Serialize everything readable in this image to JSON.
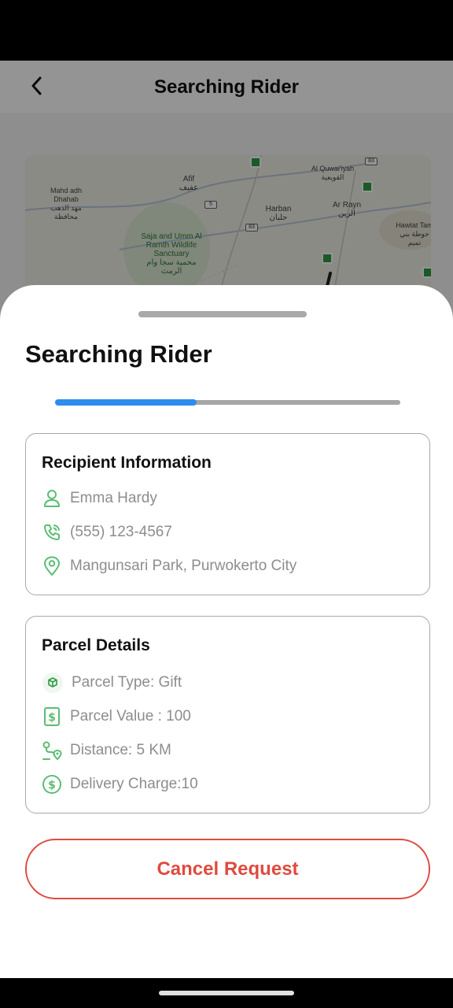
{
  "header": {
    "title": "Searching Rider"
  },
  "map": {
    "labels": [
      {
        "text": "Mahd adh Dhahab\nمهد الذهب محافظة",
        "cls": ""
      },
      {
        "text": "Afif\nعفيف",
        "cls": ""
      },
      {
        "text": "Al Quwai'iyah\nالقويعية",
        "cls": ""
      },
      {
        "text": "Harban\nحلبان",
        "cls": ""
      },
      {
        "text": "Ar Rayn\nالرين",
        "cls": ""
      },
      {
        "text": "Hawtat Tam\nحوطة بني تميم",
        "cls": ""
      },
      {
        "text": "Saja and Umm Al Ramth Wildlife Sanctuary\nمحمية سجا وام الرمث",
        "cls": "green"
      }
    ],
    "road_tags": [
      "83",
      "83",
      "5"
    ]
  },
  "sheet": {
    "title": "Searching Rider",
    "progress": 0.41
  },
  "recipient": {
    "heading": "Recipient Information",
    "name": "Emma Hardy",
    "phone": "(555) 123-4567",
    "address": "Mangunsari Park, Purwokerto City",
    "icons": [
      "person-icon",
      "phone-icon",
      "location-pin-icon"
    ]
  },
  "parcel": {
    "heading": "Parcel Details",
    "type": "Parcel Type: Gift",
    "value": "Parcel Value : 100",
    "distance": "Distance: 5 KM",
    "charge": "Delivery Charge:10",
    "icons": [
      "box-icon",
      "dollar-bill-icon",
      "route-icon",
      "dollar-coin-icon"
    ]
  },
  "actions": {
    "cancel_label": "Cancel Request"
  },
  "colors": {
    "accent_green": "#5bbd73",
    "progress_blue": "#2d8ded",
    "danger_red": "#e04a3f"
  }
}
